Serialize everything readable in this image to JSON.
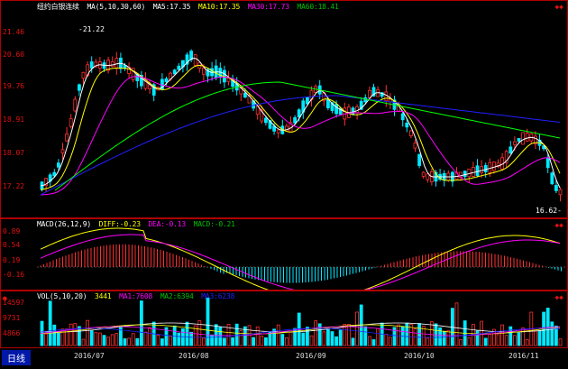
{
  "price": {
    "title": "纽约白银连续",
    "ma_label": "MA(5,10,30,60)",
    "ma5": "MA5:17.35",
    "ma10": "MA10:17.35",
    "ma30": "MA30:17.73",
    "ma60": "MA60:18.41",
    "y_ticks": [
      "21.46",
      "20.60",
      "19.76",
      "18.91",
      "18.07",
      "17.22"
    ],
    "high_annotation": "21.22",
    "low_annotation": "16.62",
    "corner": "◆◆"
  },
  "macd": {
    "label": "MACD(26,12,9)",
    "diff": "DIFF:-0.23",
    "dea": "DEA:-0.13",
    "macd": "MACD:-0.21",
    "y_ticks": [
      "0.89",
      "0.54",
      "0.19",
      "-0.16"
    ],
    "corner": "◆◆"
  },
  "vol": {
    "label": "VOL(5,10,20)",
    "value": "3441",
    "ma1": "MA1:7608",
    "ma2": "MA2:6394",
    "ma3": "MA3:6238",
    "y_ticks": [
      "14597",
      "9731",
      "4866"
    ],
    "corner": "◆◆"
  },
  "axis": {
    "tab": "日线",
    "months": [
      "2016/07",
      "2016/08",
      "2016/09",
      "2016/10",
      "2016/11"
    ]
  },
  "colors": {
    "up": "#00e8ff",
    "down": "#ff3030",
    "ma5": "#ffffff",
    "ma10": "#ffff00",
    "ma30": "#ff00ff",
    "ma60": "#00ff00",
    "ma_blue": "#2020ff",
    "frame": "#b00000"
  }
}
